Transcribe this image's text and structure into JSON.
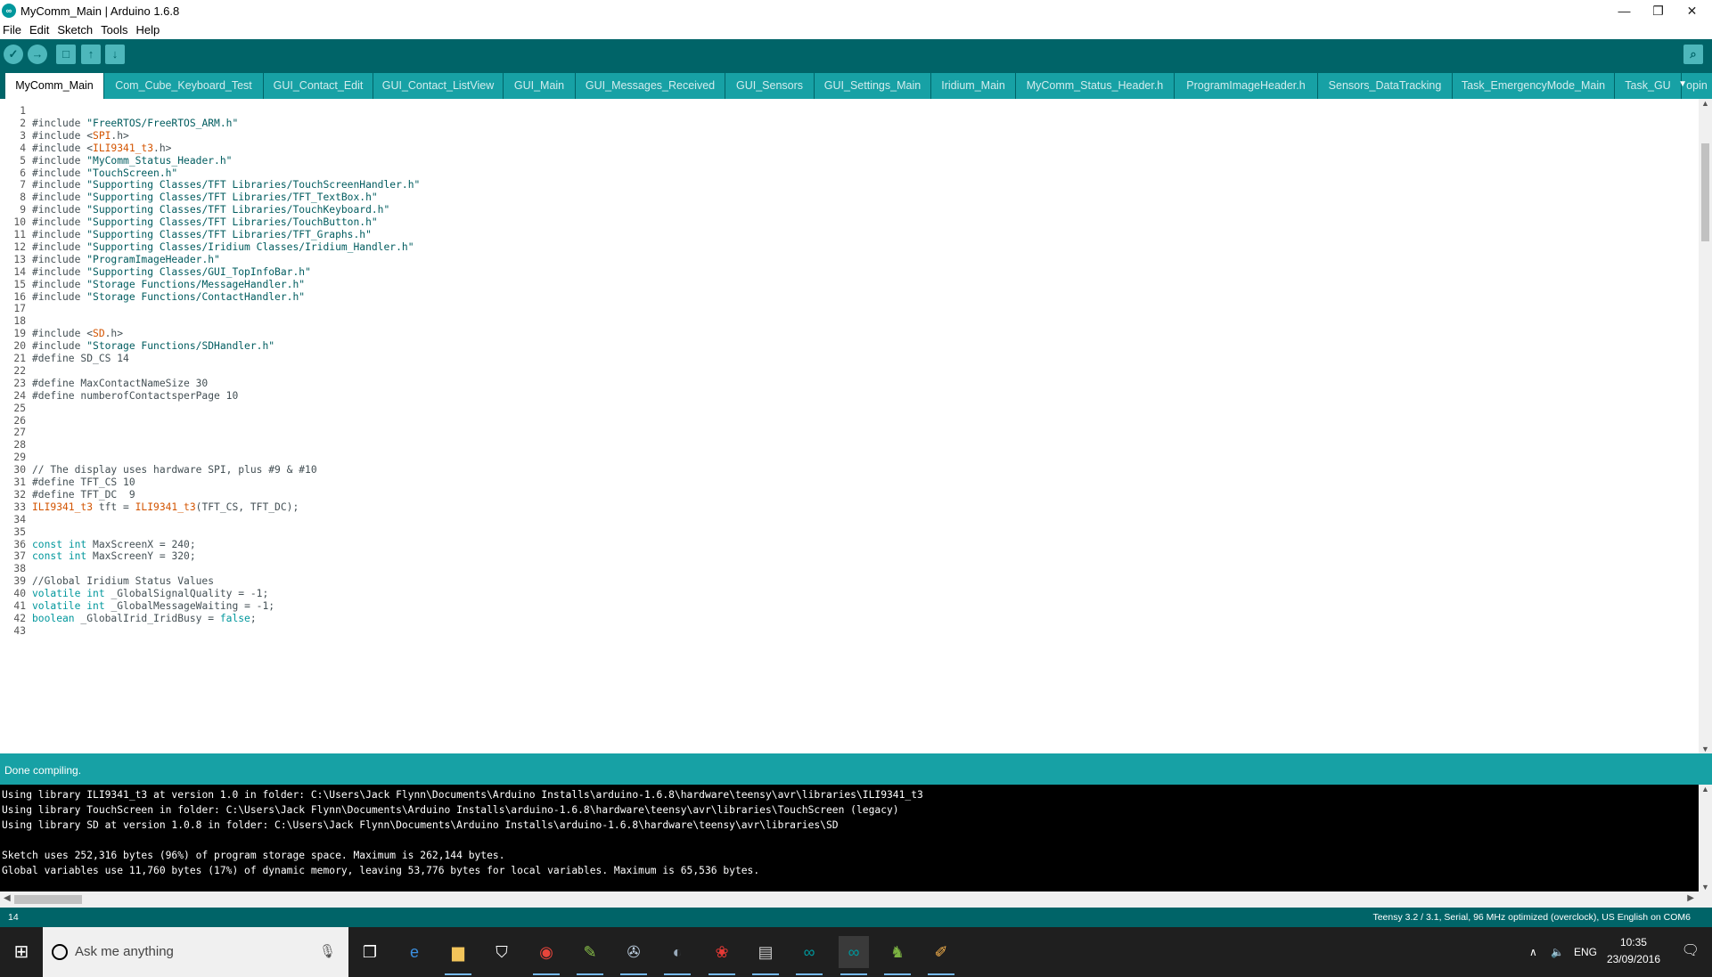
{
  "window": {
    "title": "MyComm_Main | Arduino 1.6.8",
    "controls": {
      "minimize": "—",
      "restore": "❐",
      "close": "✕"
    }
  },
  "menu": [
    "File",
    "Edit",
    "Sketch",
    "Tools",
    "Help"
  ],
  "toolbar": {
    "icons": [
      "verify-icon",
      "upload-icon",
      "new-icon",
      "open-icon",
      "save-icon",
      "serial-monitor-icon"
    ],
    "glyphs": {
      "verify": "✓",
      "upload": "→",
      "new": "□",
      "open": "↑",
      "save": "↓",
      "serial": "⌕"
    }
  },
  "tabs": [
    "MyComm_Main",
    "Com_Cube_Keyboard_Test",
    "GUI_Contact_Edit",
    "GUI_Contact_ListView",
    "GUI_Main",
    "GUI_Messages_Received",
    "GUI_Sensors",
    "GUI_Settings_Main",
    "Iridium_Main",
    "MyComm_Status_Header.h",
    "ProgramImageHeader.h",
    "Sensors_DataTracking",
    "Task_EmergencyMode_Main",
    "Task_GU"
  ],
  "tab_overflow_label": "opin",
  "active_tab": "MyComm_Main",
  "code_lines": [
    "",
    "#include \"FreeRTOS/FreeRTOS_ARM.h\"",
    "#include <SPI.h>",
    "#include <ILI9341_t3.h>",
    "#include \"MyComm_Status_Header.h\"",
    "#include \"TouchScreen.h\"",
    "#include \"Supporting Classes/TFT Libraries/TouchScreenHandler.h\"",
    "#include \"Supporting Classes/TFT Libraries/TFT_TextBox.h\"",
    "#include \"Supporting Classes/TFT Libraries/TouchKeyboard.h\"",
    "#include \"Supporting Classes/TFT Libraries/TouchButton.h\"",
    "#include \"Supporting Classes/TFT Libraries/TFT_Graphs.h\"",
    "#include \"Supporting Classes/Iridium Classes/Iridium_Handler.h\"",
    "#include \"ProgramImageHeader.h\"",
    "#include \"Supporting Classes/GUI_TopInfoBar.h\"",
    "#include \"Storage Functions/MessageHandler.h\"",
    "#include \"Storage Functions/ContactHandler.h\"",
    "",
    "",
    "#include <SD.h>",
    "#include \"Storage Functions/SDHandler.h\"",
    "#define SD_CS 14",
    "",
    "#define MaxContactNameSize 30",
    "#define numberofContactsperPage 10",
    "",
    "",
    "",
    "",
    "",
    "// The display uses hardware SPI, plus #9 & #10",
    "#define TFT_CS 10",
    "#define TFT_DC  9",
    "ILI9341_t3 tft = ILI9341_t3(TFT_CS, TFT_DC);",
    "",
    "",
    "const int MaxScreenX = 240;",
    "const int MaxScreenY = 320;",
    "",
    "//Global Iridium Status Values",
    "volatile int _GlobalSignalQuality = -1;",
    "volatile int _GlobalMessageWaiting = -1;",
    "boolean _GlobalIrid_IridBusy = false;",
    ""
  ],
  "status_message": "Done compiling.",
  "console_lines": [
    "Using library ILI9341_t3 at version 1.0 in folder: C:\\Users\\Jack Flynn\\Documents\\Arduino Installs\\arduino-1.6.8\\hardware\\teensy\\avr\\libraries\\ILI9341_t3",
    "Using library TouchScreen in folder: C:\\Users\\Jack Flynn\\Documents\\Arduino Installs\\arduino-1.6.8\\hardware\\teensy\\avr\\libraries\\TouchScreen (legacy)",
    "Using library SD at version 1.0.8 in folder: C:\\Users\\Jack Flynn\\Documents\\Arduino Installs\\arduino-1.6.8\\hardware\\teensy\\avr\\libraries\\SD",
    "",
    "Sketch uses 252,316 bytes (96%) of program storage space. Maximum is 262,144 bytes.",
    "Global variables use 11,760 bytes (17%) of dynamic memory, leaving 53,776 bytes for local variables. Maximum is 65,536 bytes."
  ],
  "footer": {
    "line_number": "14",
    "board_info": "Teensy 3.2 / 3.1, Serial, 96 MHz optimized (overclock), US English on COM6"
  },
  "taskbar": {
    "search_placeholder": "Ask me anything",
    "apps": [
      "task-view-icon",
      "edge-icon",
      "file-explorer-icon",
      "store-icon",
      "chrome-icon",
      "notepad-icon",
      "app-icon-1",
      "steam-icon",
      "raspberry-icon",
      "app-icon-2",
      "arduino-icon",
      "arduino-active-icon",
      "evernote-icon",
      "paint-icon"
    ],
    "tray": {
      "language": "ENG",
      "time": "10:35",
      "date": "23/09/2016"
    }
  },
  "colors": {
    "toolbar": "#006468",
    "tab_inactive": "#17a1a5",
    "status": "#17a1a5",
    "keyword": "#00979c",
    "library": "#d35400"
  }
}
